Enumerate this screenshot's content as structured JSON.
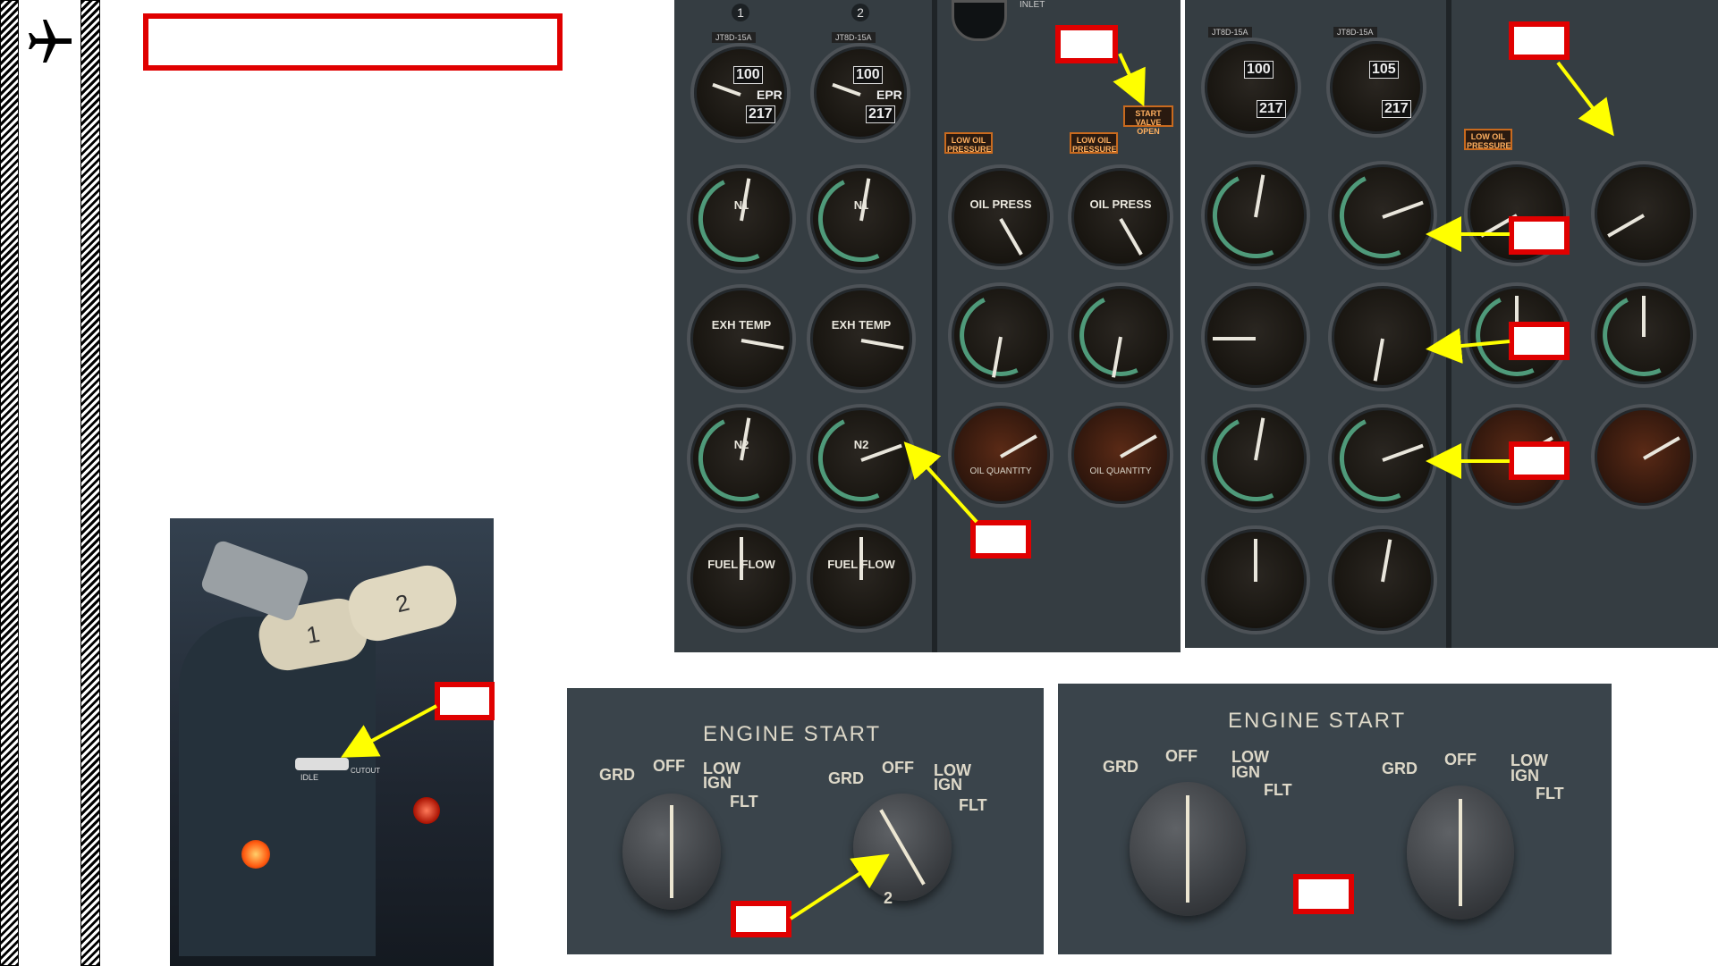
{
  "sidebar": {
    "icon": "airplane-icon"
  },
  "engine_panel_1": {
    "top_labels": [
      "1",
      "2"
    ],
    "engine_model": [
      "JT8D-15A",
      "JT8D-15A"
    ],
    "epr_readouts": [
      "100",
      "100"
    ],
    "epr_subreadouts": [
      "217",
      "217"
    ],
    "gauge_labels": {
      "epr": "EPR",
      "n1": "N1",
      "egt": "EXH TEMP",
      "n2": "N2",
      "fuel_flow": "FUEL FLOW",
      "oil_press": "OIL PRESS",
      "oil_qty": "OIL QUANTITY"
    },
    "warning_low_oil": "LOW OIL PRESSURE",
    "warning_start_valve": "START VALVE OPEN",
    "inlet_label": "INLET"
  },
  "engine_panel_2": {
    "engine_model": [
      "JT8D-15A",
      "JT8D-15A"
    ],
    "epr_readouts": [
      "100",
      "105"
    ],
    "epr_subreadouts": [
      "217",
      "217"
    ],
    "warning_low_oil": "LOW OIL PRESSURE"
  },
  "throttle": {
    "lever_1": "1",
    "lever_2": "2",
    "label_idle": "IDLE",
    "label_cutout": "CUTOUT"
  },
  "engine_start_1": {
    "title": "ENGINE START",
    "positions": [
      "GRD",
      "OFF",
      "LOW IGN",
      "FLT"
    ],
    "knob_number": "2"
  },
  "engine_start_2": {
    "title": "ENGINE START",
    "positions": [
      "GRD",
      "OFF",
      "LOW IGN",
      "FLT"
    ]
  },
  "colors": {
    "callout_border": "#e00000",
    "arrow": "#ffff00"
  }
}
